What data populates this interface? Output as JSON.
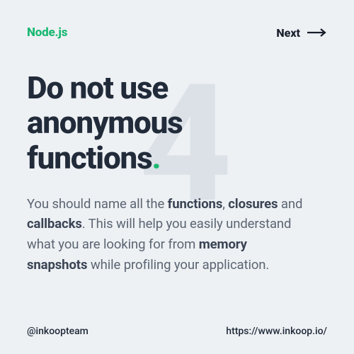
{
  "header": {
    "category": "Node.js",
    "next_label": "Next"
  },
  "watermark": "4",
  "title_lines": [
    "Do not use",
    "anonymous",
    "functions"
  ],
  "body": {
    "p1_a": "You should name all the ",
    "p1_b1": "functions",
    "p1_c": ", ",
    "p1_b2": "closures",
    "p1_d": " and ",
    "p1_b3": "callbacks",
    "p1_e": ". This will help you easily understand what you are looking for from ",
    "p1_b4": "memory snapshots",
    "p1_f": " while profiling your application."
  },
  "footer": {
    "handle": "@inkoopteam",
    "url": "https://www.inkoop.io/"
  }
}
